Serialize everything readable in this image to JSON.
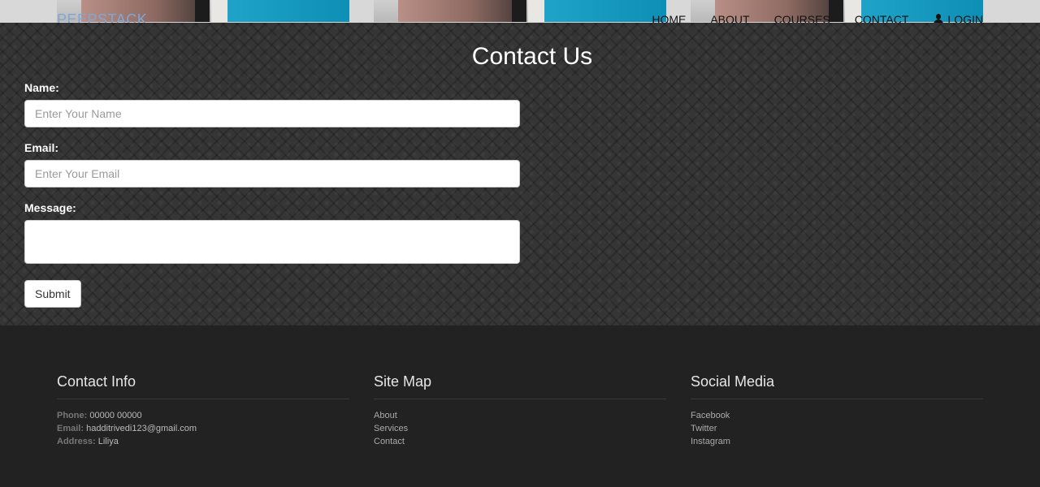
{
  "navbar": {
    "brand": "PEEPSTACK",
    "links": [
      "HOME",
      "ABOUT",
      "COURSES",
      "CONTACT"
    ],
    "login_label": "LOGIN"
  },
  "contact": {
    "title": "Contact Us",
    "name_label": "Name:",
    "name_placeholder": "Enter Your Name",
    "email_label": "Email:",
    "email_placeholder": "Enter Your Email",
    "message_label": "Message:",
    "submit_label": "Submit"
  },
  "footer": {
    "contact_info": {
      "title": "Contact Info",
      "phone_label": "Phone:",
      "phone": "00000 00000",
      "email_label": "Email:",
      "email": "hadditrivedi123@gmail.com",
      "address_label": "Address:",
      "address": "Liliya"
    },
    "site_map": {
      "title": "Site Map",
      "items": [
        "About",
        "Services",
        "Contact"
      ]
    },
    "social_media": {
      "title": "Social Media",
      "items": [
        "Facebook",
        "Twitter",
        "Instagram"
      ]
    }
  }
}
